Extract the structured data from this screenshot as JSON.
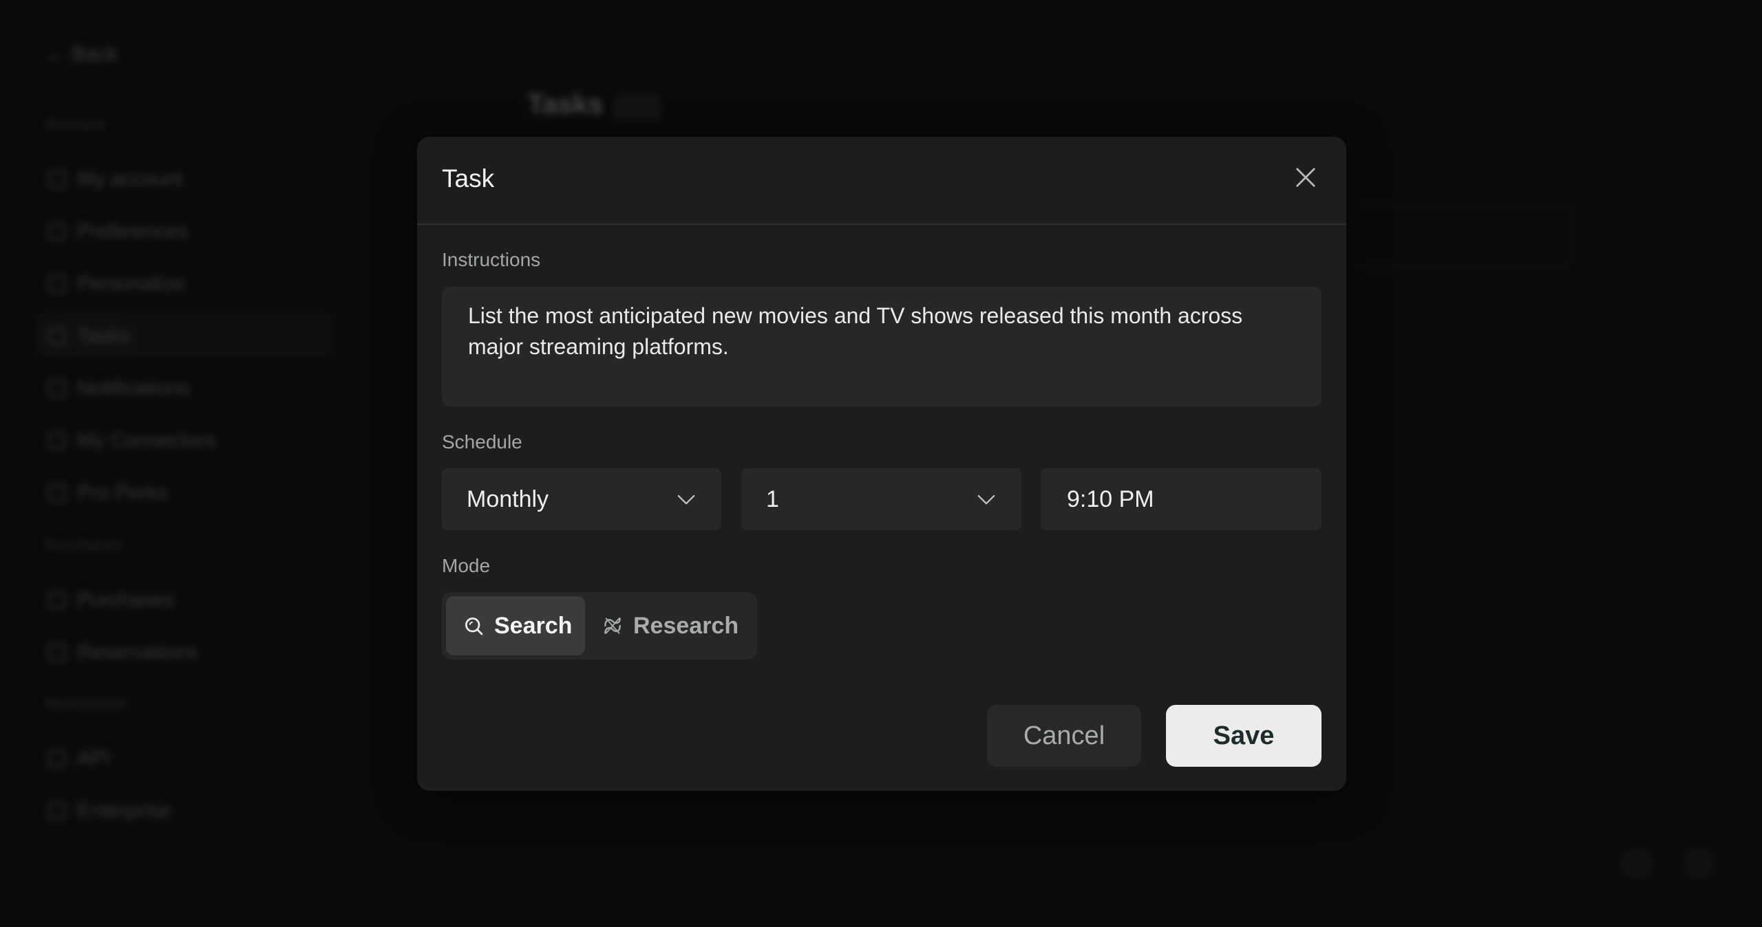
{
  "background": {
    "back_label": "Back",
    "sections": [
      "Account",
      "Purchases",
      "Workspace"
    ],
    "nav_items": [
      "My account",
      "Preferences",
      "Personalize",
      "Tasks",
      "Notifications",
      "My Connectors",
      "Pro Perks",
      "Purchases",
      "Reservations",
      "API",
      "Enterprise"
    ],
    "page_title": "Tasks"
  },
  "modal": {
    "title": "Task",
    "close_icon": "close-icon",
    "instructions_label": "Instructions",
    "instructions_text": "List the most anticipated new movies and TV shows released this month across major streaming platforms.",
    "schedule_label": "Schedule",
    "frequency": "Monthly",
    "day": "1",
    "time": "9:10 PM",
    "mode_label": "Mode",
    "modes": [
      {
        "label": "Search",
        "icon": "search-icon",
        "selected": true
      },
      {
        "label": "Research",
        "icon": "research-icon",
        "selected": false
      }
    ],
    "cancel_label": "Cancel",
    "save_label": "Save"
  },
  "colors": {
    "modal_bg": "#1c1e1e",
    "field_bg": "#252827",
    "save_bg": "#ececea",
    "save_text": "#1c2b2b"
  }
}
